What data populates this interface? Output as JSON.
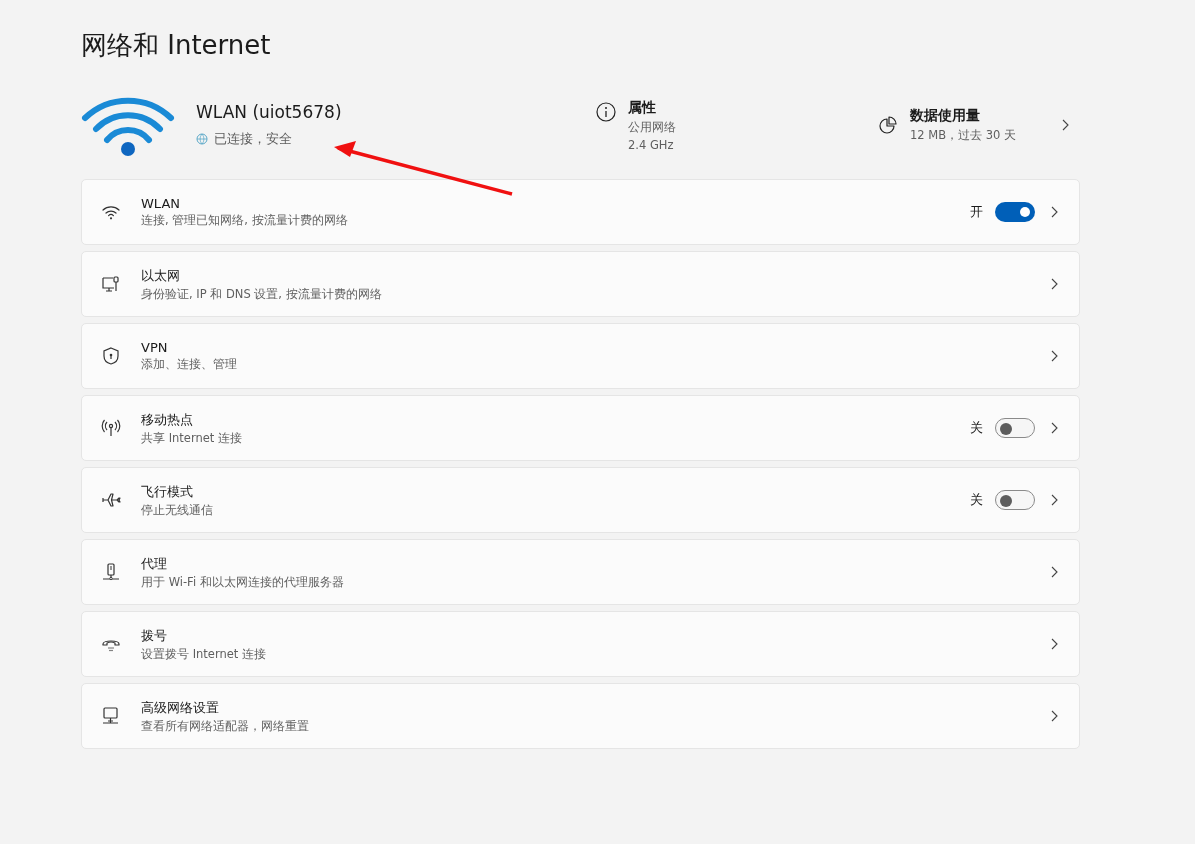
{
  "page_title": "网络和 Internet",
  "connection": {
    "name": "WLAN (uiot5678)",
    "status": "已连接，安全"
  },
  "properties": {
    "label": "属性",
    "lines": [
      "公用网络",
      "2.4 GHz"
    ]
  },
  "data_usage": {
    "label": "数据使用量",
    "detail": "12 MB，过去 30 天"
  },
  "settings": [
    {
      "kind": "toggle",
      "title": "WLAN",
      "subtitle": "连接, 管理已知网络, 按流量计费的网络",
      "state_label": "开",
      "on": true
    },
    {
      "kind": "link",
      "title": "以太网",
      "subtitle": "身份验证, IP 和 DNS 设置, 按流量计费的网络"
    },
    {
      "kind": "link",
      "title": "VPN",
      "subtitle": "添加、连接、管理"
    },
    {
      "kind": "toggle",
      "title": "移动热点",
      "subtitle": "共享 Internet 连接",
      "state_label": "关",
      "on": false
    },
    {
      "kind": "toggle",
      "title": "飞行模式",
      "subtitle": "停止无线通信",
      "state_label": "关",
      "on": false
    },
    {
      "kind": "link",
      "title": "代理",
      "subtitle": "用于 Wi-Fi 和以太网连接的代理服务器"
    },
    {
      "kind": "link",
      "title": "拨号",
      "subtitle": "设置拨号 Internet 连接"
    },
    {
      "kind": "link",
      "title": "高级网络设置",
      "subtitle": "查看所有网络适配器，网络重置"
    }
  ]
}
